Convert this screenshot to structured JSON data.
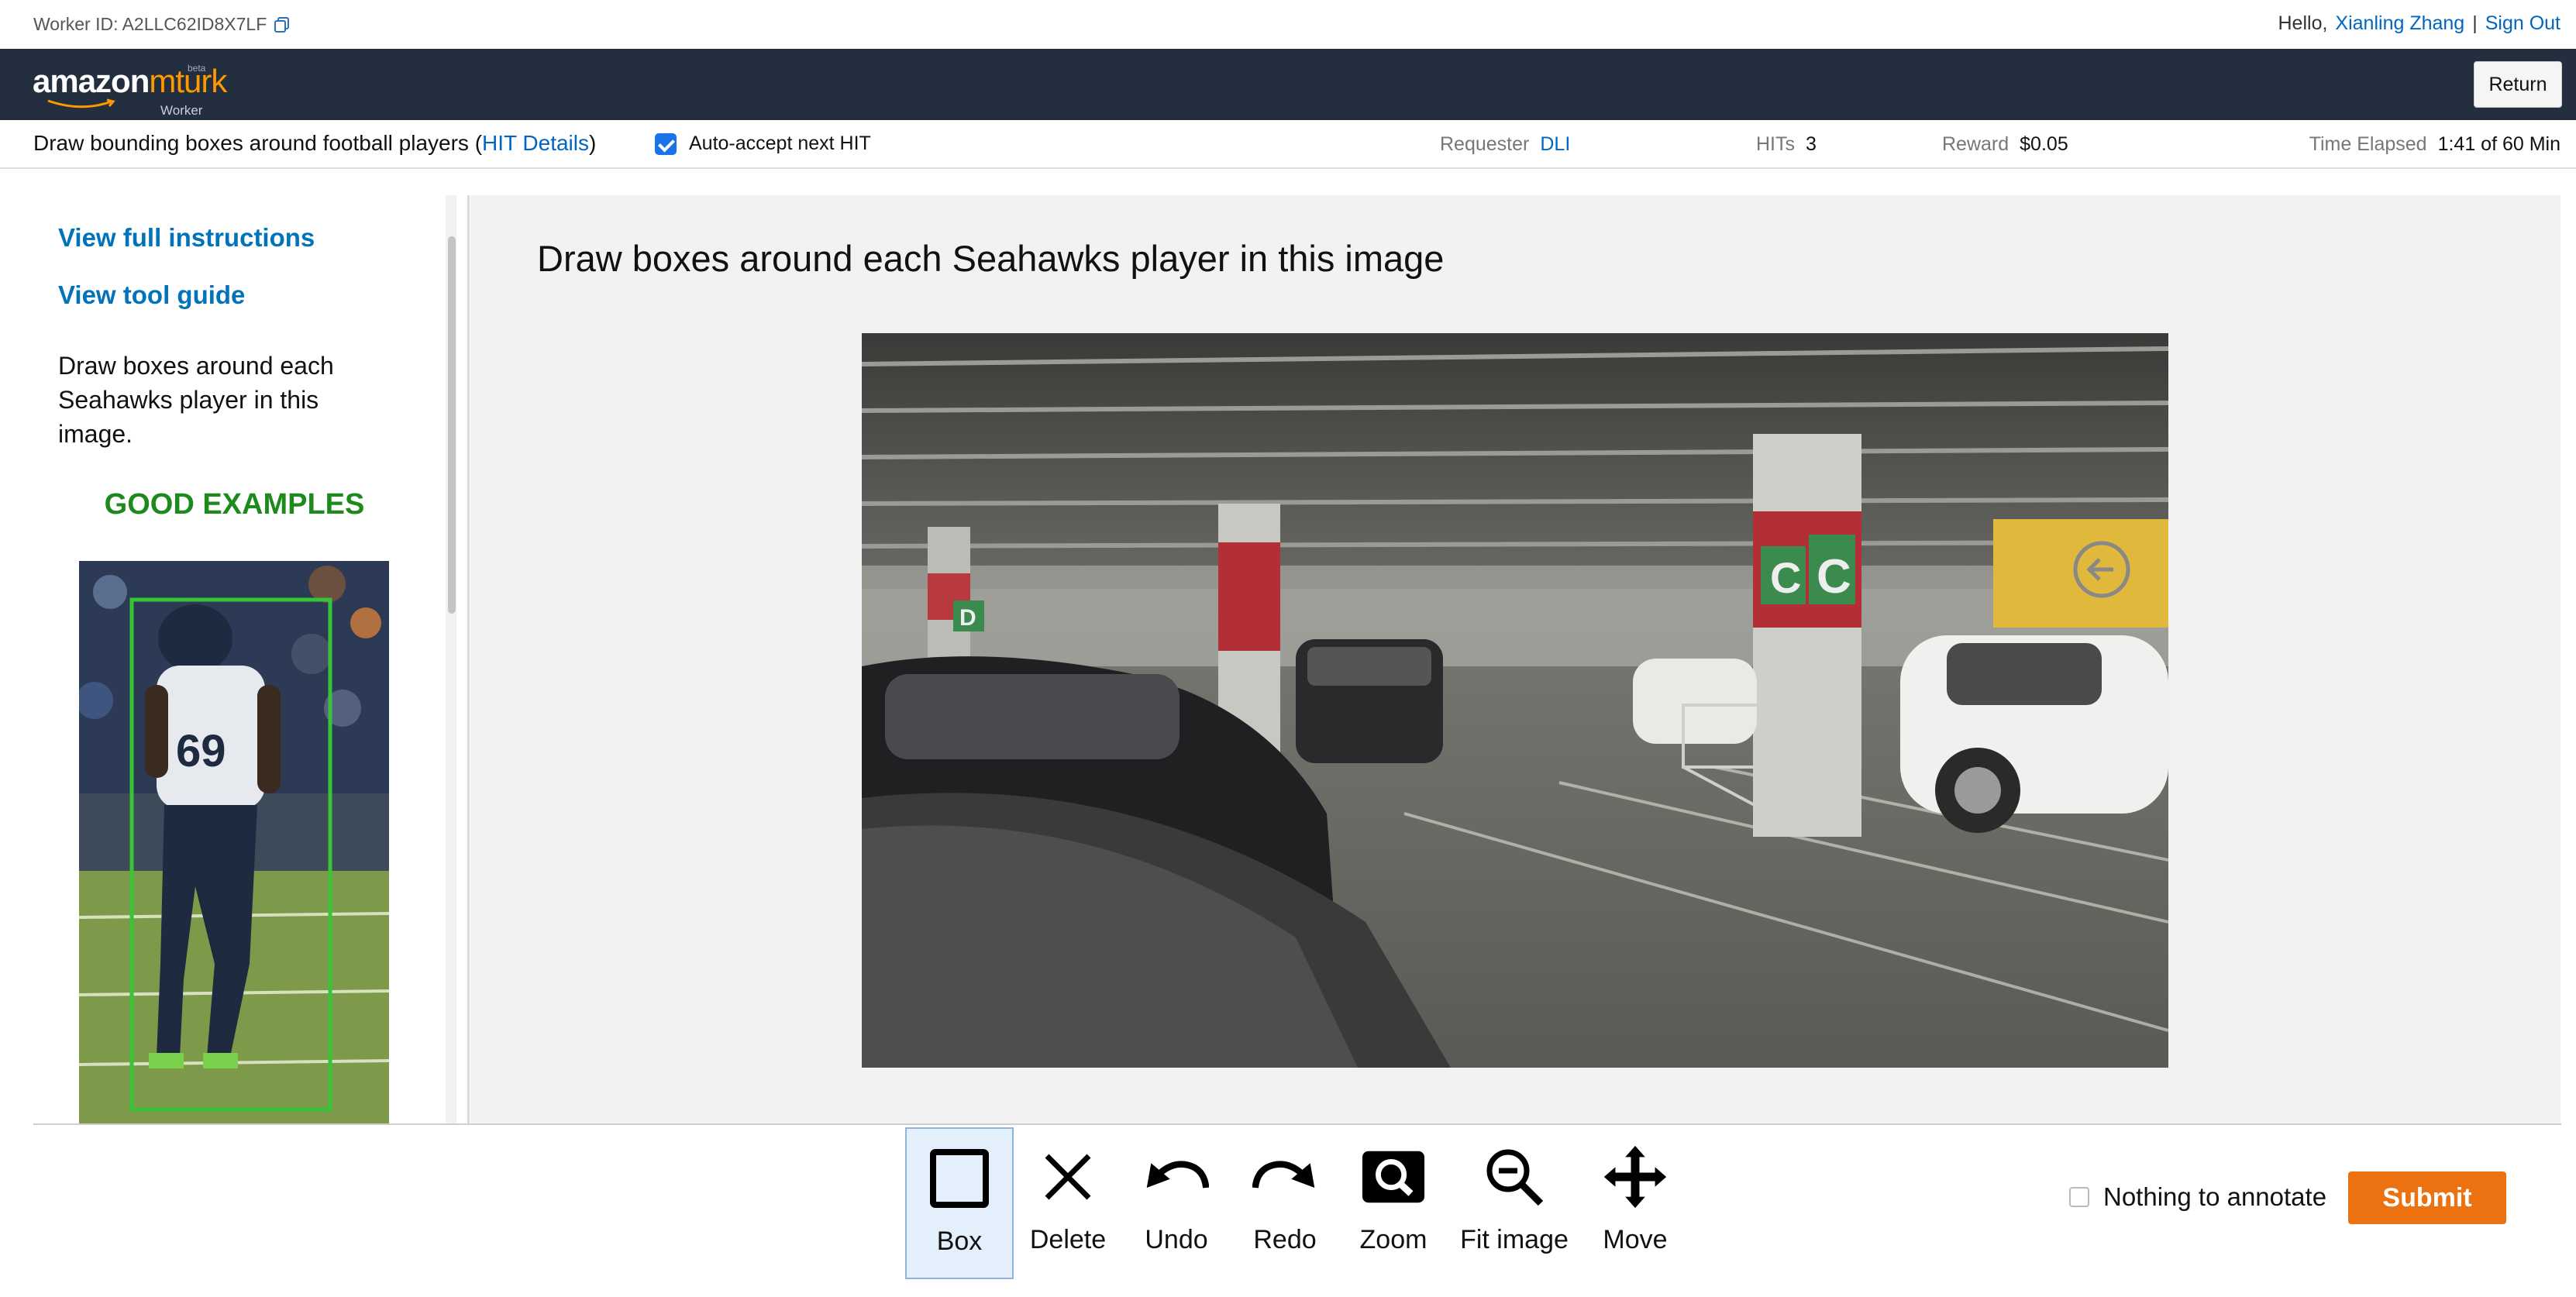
{
  "worker_bar": {
    "worker_id": "Worker ID: A2LLC62ID8X7LF",
    "greeting": "Hello,",
    "user_name": "Xianling Zhang",
    "separator": "|",
    "sign_out": "Sign Out"
  },
  "header": {
    "logo_amazon": "amazon",
    "logo_mturk": "mturk",
    "logo_beta": "beta",
    "logo_worker": "Worker",
    "return_label": "Return"
  },
  "hit_bar": {
    "title": "Draw bounding boxes around football players",
    "open_paren": "(",
    "details_link": "HIT Details",
    "close_paren": ")",
    "auto_accept_label": "Auto-accept next HIT",
    "auto_accept_checked": true,
    "requester_label": "Requester",
    "requester_value": "DLI",
    "hits_label": "HITs",
    "hits_value": "3",
    "reward_label": "Reward",
    "reward_value": "$0.05",
    "time_label": "Time Elapsed",
    "time_value": "1:41 of 60 Min"
  },
  "instructions": {
    "full_instructions_link": "View full instructions",
    "tool_guide_link": "View tool guide",
    "text": "Draw boxes around each Seahawks player in this image.",
    "good_examples": "GOOD EXAMPLES",
    "example_player_number": "69"
  },
  "work": {
    "title": "Draw boxes around each Seahawks player in this image",
    "sign_letters": [
      "D",
      "C",
      "C"
    ]
  },
  "toolbar": {
    "tools": [
      {
        "label": "Box",
        "icon": "square-icon",
        "active": true
      },
      {
        "label": "Delete",
        "icon": "x-icon",
        "active": false
      },
      {
        "label": "Undo",
        "icon": "undo-icon",
        "active": false
      },
      {
        "label": "Redo",
        "icon": "redo-icon",
        "active": false
      },
      {
        "label": "Zoom",
        "icon": "zoom-icon",
        "active": false
      },
      {
        "label": "Fit image",
        "icon": "zoom-out-icon",
        "active": false
      },
      {
        "label": "Move",
        "icon": "move-icon",
        "active": false
      }
    ],
    "nothing_label": "Nothing to annotate",
    "submit_label": "Submit"
  },
  "colors": {
    "header_bg": "#232f3e",
    "brand_orange": "#ff9900",
    "link_blue": "#0066c0",
    "submit_orange": "#ec7211",
    "good_green": "#1e8a1e"
  }
}
